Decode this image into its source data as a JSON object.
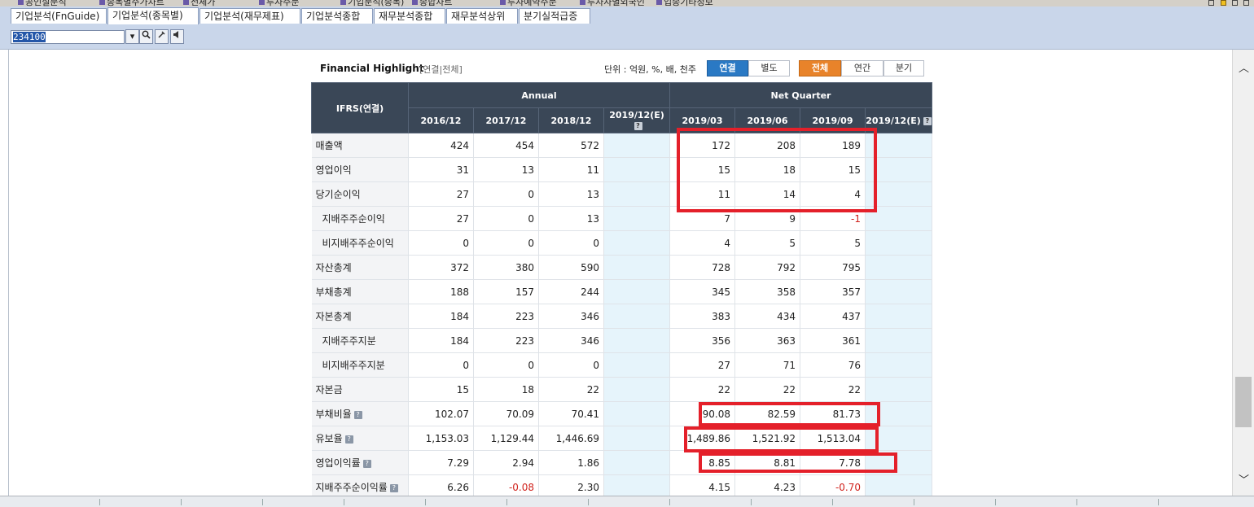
{
  "top_tabs": [
    "공인실분석",
    "종목별주가차트",
    "전체가",
    "투자주문",
    "기업분석(종목)",
    "종합차트",
    "투자예약주문",
    "투자자별외국인",
    "업종기타정보"
  ],
  "tabs": [
    "기업분석(FnGuide)",
    "기업분석(종목별)",
    "기업분석(재무제표)",
    "기업분석종합",
    "재무분석종합",
    "재무분석상위",
    "분기실적급증"
  ],
  "active_tab": 1,
  "stock_code": "234100",
  "panel": {
    "title": "Financial Highlight",
    "subtitle": "[연결|전체]",
    "unit": "단위 : 억원, %, 배, 천주",
    "consolidation_buttons": [
      "연결",
      "별도"
    ],
    "period_buttons": [
      "전체",
      "연간",
      "분기"
    ]
  },
  "table": {
    "row_header": "IFRS(연결)",
    "group_annual": "Annual",
    "group_quarter": "Net Quarter",
    "columns": [
      "2016/12",
      "2017/12",
      "2018/12",
      "2019/12(E)",
      "2019/03",
      "2019/06",
      "2019/09",
      "2019/12(E)"
    ],
    "rows": [
      {
        "label": "매출액",
        "sub": false,
        "help": false,
        "values": [
          "424",
          "454",
          "572",
          "",
          "172",
          "208",
          "189",
          ""
        ]
      },
      {
        "label": "영업이익",
        "sub": false,
        "help": false,
        "values": [
          "31",
          "13",
          "11",
          "",
          "15",
          "18",
          "15",
          ""
        ]
      },
      {
        "label": "당기순이익",
        "sub": false,
        "help": false,
        "values": [
          "27",
          "0",
          "13",
          "",
          "11",
          "14",
          "4",
          ""
        ]
      },
      {
        "label": "지배주주순이익",
        "sub": true,
        "help": false,
        "values": [
          "27",
          "0",
          "13",
          "",
          "7",
          "9",
          "-1",
          ""
        ]
      },
      {
        "label": "비지배주주순이익",
        "sub": true,
        "help": false,
        "values": [
          "0",
          "0",
          "0",
          "",
          "4",
          "5",
          "5",
          ""
        ]
      },
      {
        "label": "자산총계",
        "sub": false,
        "help": false,
        "values": [
          "372",
          "380",
          "590",
          "",
          "728",
          "792",
          "795",
          ""
        ]
      },
      {
        "label": "부채총계",
        "sub": false,
        "help": false,
        "values": [
          "188",
          "157",
          "244",
          "",
          "345",
          "358",
          "357",
          ""
        ]
      },
      {
        "label": "자본총계",
        "sub": false,
        "help": false,
        "values": [
          "184",
          "223",
          "346",
          "",
          "383",
          "434",
          "437",
          ""
        ]
      },
      {
        "label": "지배주주지분",
        "sub": true,
        "help": false,
        "values": [
          "184",
          "223",
          "346",
          "",
          "356",
          "363",
          "361",
          ""
        ]
      },
      {
        "label": "비지배주주지분",
        "sub": true,
        "help": false,
        "values": [
          "0",
          "0",
          "0",
          "",
          "27",
          "71",
          "76",
          ""
        ]
      },
      {
        "label": "자본금",
        "sub": false,
        "help": false,
        "values": [
          "15",
          "18",
          "22",
          "",
          "22",
          "22",
          "22",
          ""
        ]
      },
      {
        "label": "부채비율",
        "sub": false,
        "help": true,
        "values": [
          "102.07",
          "70.09",
          "70.41",
          "",
          "90.08",
          "82.59",
          "81.73",
          ""
        ]
      },
      {
        "label": "유보율",
        "sub": false,
        "help": true,
        "values": [
          "1,153.03",
          "1,129.44",
          "1,446.69",
          "",
          "1,489.86",
          "1,521.92",
          "1,513.04",
          ""
        ]
      },
      {
        "label": "영업이익률",
        "sub": false,
        "help": true,
        "values": [
          "7.29",
          "2.94",
          "1.86",
          "",
          "8.85",
          "8.81",
          "7.78",
          ""
        ]
      },
      {
        "label": "지배주주순이익률",
        "sub": false,
        "help": true,
        "values": [
          "6.26",
          "-0.08",
          "2.30",
          "",
          "4.15",
          "4.23",
          "-0.70",
          ""
        ]
      }
    ]
  },
  "colors": {
    "header_bg": "#3a4757",
    "estimate_bg": "#e6f4fb",
    "negative": "#d0221c",
    "highlight_box": "#e4202a",
    "active_blue": "#2a79c4",
    "active_orange": "#e8832a"
  }
}
